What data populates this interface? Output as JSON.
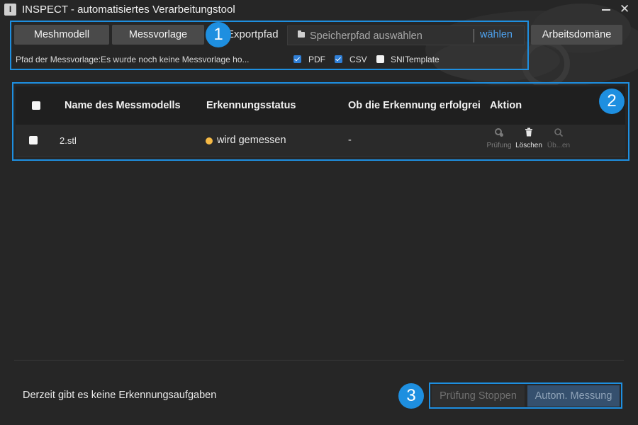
{
  "window": {
    "title": "INSPECT - automatisiertes Verarbeitungstool",
    "icon_letter": "I"
  },
  "toolbar": {
    "mesh_button": "Meshmodell",
    "template_button": "Messvorlage",
    "export_label": "Exportpfad",
    "path_placeholder": "Speicherpfad auswählen",
    "path_choose": "wählen",
    "domain_button": "Arbeitsdomäne",
    "template_path_text": "Pfad der Messvorlage:Es wurde noch keine Messvorlage ho...",
    "formats": [
      {
        "label": "PDF",
        "checked": true
      },
      {
        "label": "CSV",
        "checked": true
      },
      {
        "label": "SNITemplate",
        "checked": false
      }
    ]
  },
  "table": {
    "headers": {
      "name": "Name des Messmodells",
      "status": "Erkennungsstatus",
      "success": "Ob die Erkennung erfolgrei",
      "action": "Aktion"
    },
    "rows": [
      {
        "name": "2.stl",
        "status": "wird gemessen",
        "success": "-",
        "actions": {
          "check": "Prüfung",
          "delete": "Löschen",
          "view": "Üb...en"
        }
      }
    ]
  },
  "footer": {
    "message": "Derzeit gibt es keine Erkennungsaufgaben",
    "stop_button": "Prüfung Stoppen",
    "auto_button": "Autom. Messung"
  },
  "annotations": [
    "1",
    "2",
    "3"
  ],
  "colors": {
    "accent": "#1e8fe0",
    "link": "#4ea3f0",
    "status_measuring": "#f5b945",
    "checkbox": "#2f7fd7"
  }
}
